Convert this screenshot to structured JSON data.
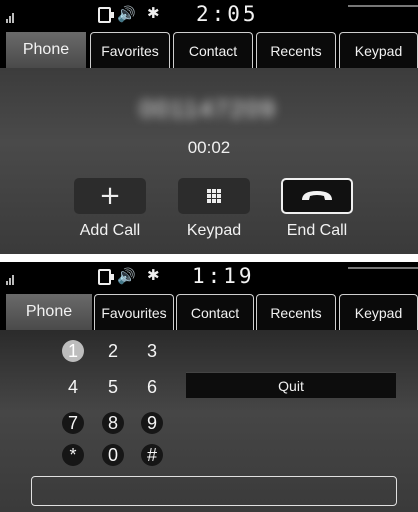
{
  "screen1": {
    "status": {
      "time": "2:05"
    },
    "tabs": [
      "Phone",
      "Favorites",
      "Contact",
      "Recents",
      "Keypad"
    ],
    "call": {
      "number": "001147209",
      "duration": "00:02",
      "buttons": [
        {
          "label": "Add Call",
          "icon": "plus-icon"
        },
        {
          "label": "Keypad",
          "icon": "keypad-grid-icon"
        },
        {
          "label": "End Call",
          "icon": "hang-up-icon"
        }
      ]
    }
  },
  "screen2": {
    "status": {
      "time": "1:19"
    },
    "tabs": [
      "Phone",
      "Favourites",
      "Contact",
      "Recents",
      "Keypad"
    ],
    "keypad": {
      "keys": [
        "1",
        "2",
        "3",
        "4",
        "5",
        "6",
        "7",
        "8",
        "9",
        "*",
        "0",
        "#"
      ],
      "highlighted_key": "1"
    },
    "quit_label": "Quit",
    "number_field": ""
  }
}
